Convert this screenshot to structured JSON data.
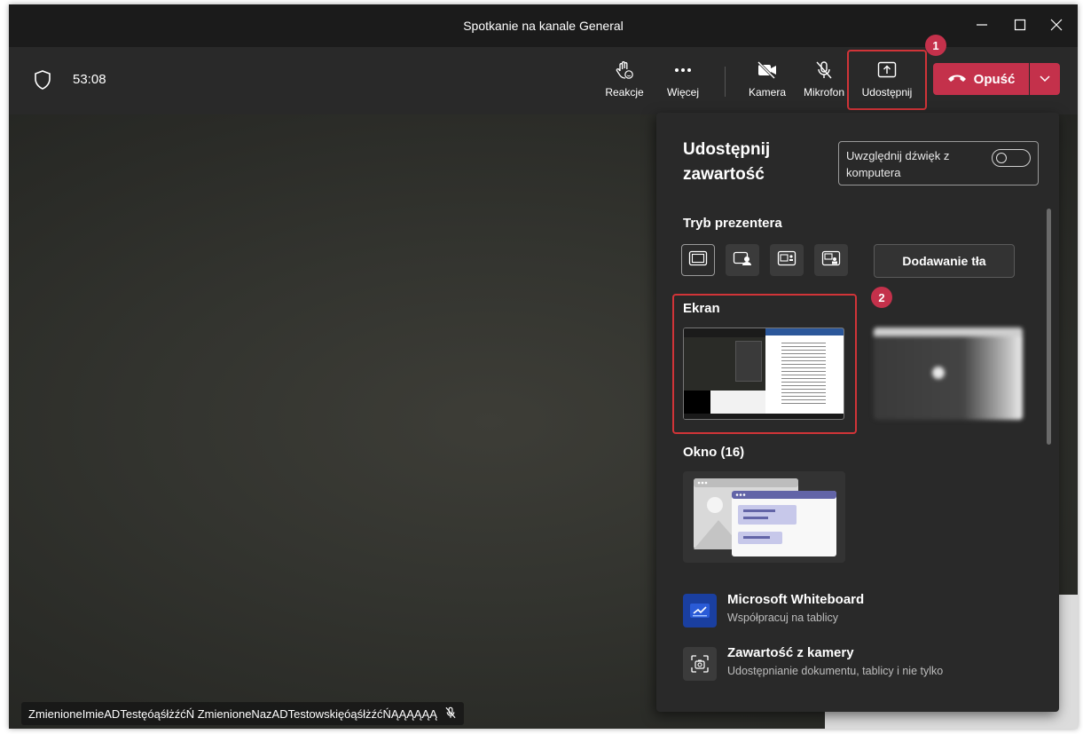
{
  "window": {
    "title": "Spotkanie na kanale General"
  },
  "toolbar": {
    "timer": "53:08",
    "reactions_label": "Reakcje",
    "more_label": "Więcej",
    "camera_label": "Kamera",
    "mic_label": "Mikrofon",
    "share_label": "Udostępnij",
    "leave_label": "Opuść"
  },
  "annotations": {
    "one": "1",
    "two": "2"
  },
  "share_panel": {
    "title": "Udostępnij zawartość",
    "audio_toggle_label": "Uwzględnij dźwięk z komputera",
    "audio_toggle_on": false,
    "presenter_mode_title": "Tryb prezentera",
    "background_button": "Dodawanie tła",
    "screen_section": "Ekran",
    "window_section": "Okno (16)",
    "apps": [
      {
        "name": "Microsoft Whiteboard",
        "desc": "Współpracuj na tablicy",
        "icon": "whiteboard-icon"
      },
      {
        "name": "Zawartość z kamery",
        "desc": "Udostępnianie dokumentu, tablicy i nie tylko",
        "icon": "camera-content-icon"
      }
    ]
  },
  "participant": {
    "name": "ZmienioneImieADTestęóąśłżźćŃ ZmienioneNazADTestowskięóąśłżźćŃĄĄĄĄĄĄ"
  },
  "colors": {
    "leave_red": "#c4314b",
    "annotation_red": "#d13438",
    "panel_bg": "#292929",
    "toolbar_bg": "#292929"
  }
}
